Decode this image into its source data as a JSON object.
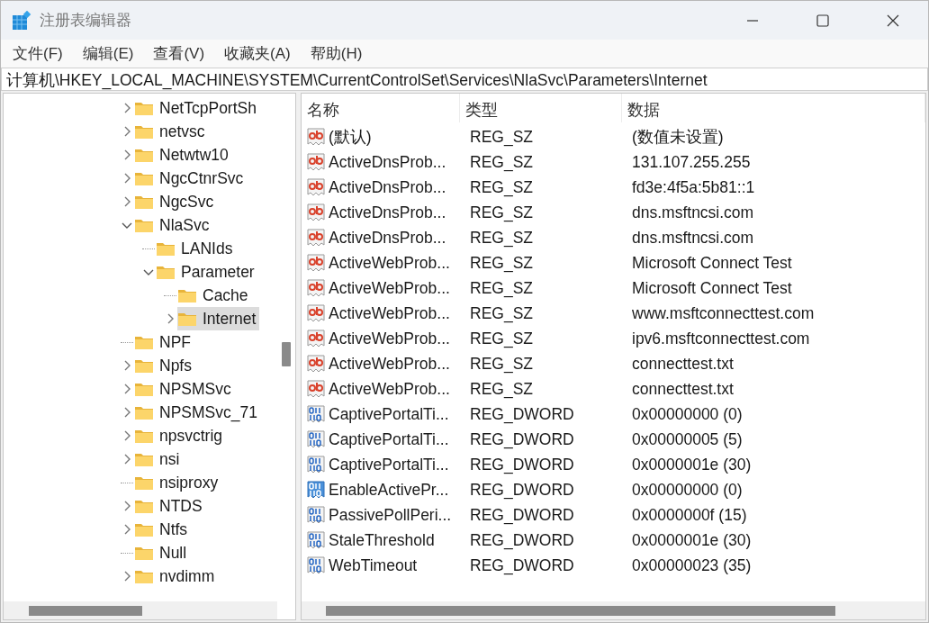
{
  "window": {
    "title": "注册表编辑器"
  },
  "menu": [
    "文件(F)",
    "编辑(E)",
    "查看(V)",
    "收藏夹(A)",
    "帮助(H)"
  ],
  "address": "计算机\\HKEY_LOCAL_MACHINE\\SYSTEM\\CurrentControlSet\\Services\\NlaSvc\\Parameters\\Internet",
  "tree": {
    "items": [
      {
        "label": "NetTcpPortSh",
        "has_subkeys": true,
        "expanded": false,
        "selected": false
      },
      {
        "label": "netvsc",
        "has_subkeys": true,
        "expanded": false,
        "selected": false
      },
      {
        "label": "Netwtw10",
        "has_subkeys": true,
        "expanded": false,
        "selected": false
      },
      {
        "label": "NgcCtnrSvc",
        "has_subkeys": true,
        "expanded": false,
        "selected": false
      },
      {
        "label": "NgcSvc",
        "has_subkeys": true,
        "expanded": false,
        "selected": false
      },
      {
        "label": "NlaSvc",
        "expanded": true,
        "selected": false,
        "children": [
          {
            "label": "LANIds",
            "has_subkeys": false,
            "expanded": false,
            "selected": false
          },
          {
            "label": "Parameter",
            "expanded": true,
            "selected": false,
            "children": [
              {
                "label": "Cache",
                "has_subkeys": false,
                "expanded": false,
                "selected": false
              },
              {
                "label": "Internet",
                "has_subkeys": true,
                "expanded": false,
                "selected": true
              }
            ]
          }
        ]
      },
      {
        "label": "NPF",
        "has_subkeys": false,
        "expanded": false,
        "selected": false
      },
      {
        "label": "Npfs",
        "has_subkeys": true,
        "expanded": false,
        "selected": false
      },
      {
        "label": "NPSMSvc",
        "has_subkeys": true,
        "expanded": false,
        "selected": false
      },
      {
        "label": "NPSMSvc_71",
        "has_subkeys": true,
        "expanded": false,
        "selected": false
      },
      {
        "label": "npsvctrig",
        "has_subkeys": true,
        "expanded": false,
        "selected": false
      },
      {
        "label": "nsi",
        "has_subkeys": true,
        "expanded": false,
        "selected": false
      },
      {
        "label": "nsiproxy",
        "has_subkeys": false,
        "expanded": false,
        "selected": false
      },
      {
        "label": "NTDS",
        "has_subkeys": true,
        "expanded": false,
        "selected": false
      },
      {
        "label": "Ntfs",
        "has_subkeys": true,
        "expanded": false,
        "selected": false
      },
      {
        "label": "Null",
        "has_subkeys": false,
        "expanded": false,
        "selected": false
      },
      {
        "label": "nvdimm",
        "has_subkeys": true,
        "expanded": false,
        "selected": false
      }
    ]
  },
  "list": {
    "columns": [
      "名称",
      "类型",
      "数据"
    ],
    "rows": [
      {
        "kind": "string",
        "name": "(默认)",
        "type": "REG_SZ",
        "data": "(数值未设置)",
        "selected": false
      },
      {
        "kind": "string",
        "name": "ActiveDnsProb...",
        "type": "REG_SZ",
        "data": "131.107.255.255",
        "selected": false
      },
      {
        "kind": "string",
        "name": "ActiveDnsProb...",
        "type": "REG_SZ",
        "data": "fd3e:4f5a:5b81::1",
        "selected": false
      },
      {
        "kind": "string",
        "name": "ActiveDnsProb...",
        "type": "REG_SZ",
        "data": "dns.msftncsi.com",
        "selected": false
      },
      {
        "kind": "string",
        "name": "ActiveDnsProb...",
        "type": "REG_SZ",
        "data": "dns.msftncsi.com",
        "selected": false
      },
      {
        "kind": "string",
        "name": "ActiveWebProb...",
        "type": "REG_SZ",
        "data": "Microsoft Connect Test",
        "selected": false
      },
      {
        "kind": "string",
        "name": "ActiveWebProb...",
        "type": "REG_SZ",
        "data": "Microsoft Connect Test",
        "selected": false
      },
      {
        "kind": "string",
        "name": "ActiveWebProb...",
        "type": "REG_SZ",
        "data": "www.msftconnecttest.com",
        "selected": false
      },
      {
        "kind": "string",
        "name": "ActiveWebProb...",
        "type": "REG_SZ",
        "data": "ipv6.msftconnecttest.com",
        "selected": false
      },
      {
        "kind": "string",
        "name": "ActiveWebProb...",
        "type": "REG_SZ",
        "data": "connecttest.txt",
        "selected": false
      },
      {
        "kind": "string",
        "name": "ActiveWebProb...",
        "type": "REG_SZ",
        "data": "connecttest.txt",
        "selected": false
      },
      {
        "kind": "binary",
        "name": "CaptivePortalTi...",
        "type": "REG_DWORD",
        "data": "0x00000000 (0)",
        "selected": false
      },
      {
        "kind": "binary",
        "name": "CaptivePortalTi...",
        "type": "REG_DWORD",
        "data": "0x00000005 (5)",
        "selected": false
      },
      {
        "kind": "binary",
        "name": "CaptivePortalTi...",
        "type": "REG_DWORD",
        "data": "0x0000001e (30)",
        "selected": false
      },
      {
        "kind": "binary",
        "name": "EnableActivePr...",
        "type": "REG_DWORD",
        "data": "0x00000000 (0)",
        "selected": true
      },
      {
        "kind": "binary",
        "name": "PassivePollPeri...",
        "type": "REG_DWORD",
        "data": "0x0000000f (15)",
        "selected": false
      },
      {
        "kind": "binary",
        "name": "StaleThreshold",
        "type": "REG_DWORD",
        "data": "0x0000001e (30)",
        "selected": false
      },
      {
        "kind": "binary",
        "name": "WebTimeout",
        "type": "REG_DWORD",
        "data": "0x00000023 (35)",
        "selected": false
      }
    ]
  }
}
